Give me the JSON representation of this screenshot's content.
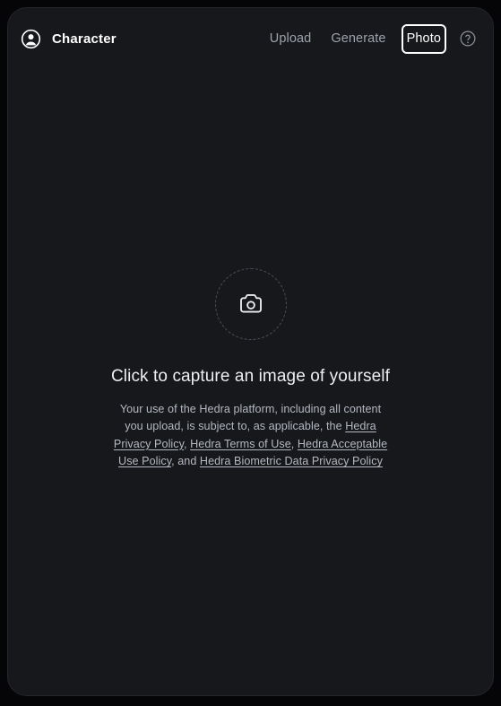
{
  "window": {
    "background_color": "#050507",
    "card_color": "#17181c"
  },
  "header": {
    "avatar_icon": "user-circle-icon",
    "title": "Character",
    "tabs": [
      {
        "label": "Upload",
        "active": false
      },
      {
        "label": "Generate",
        "active": false
      },
      {
        "label": "Photo",
        "active": true
      }
    ],
    "help_icon": "question-mark-circle-icon"
  },
  "capture": {
    "drop_icon": "camera-icon",
    "headline": "Click to capture an image of yourself",
    "legal": {
      "intro": "Your use of the Hedra platform, including all content you upload, is subject to, as applicable, the ",
      "link1": "Hedra Privacy Policy",
      "sep1": ", ",
      "link2": "Hedra Terms of Use",
      "sep2": ", ",
      "link3": "Hedra Acceptable Use Policy",
      "sep3": ", and ",
      "link4": "Hedra Biometric Data Privacy Policy"
    }
  }
}
